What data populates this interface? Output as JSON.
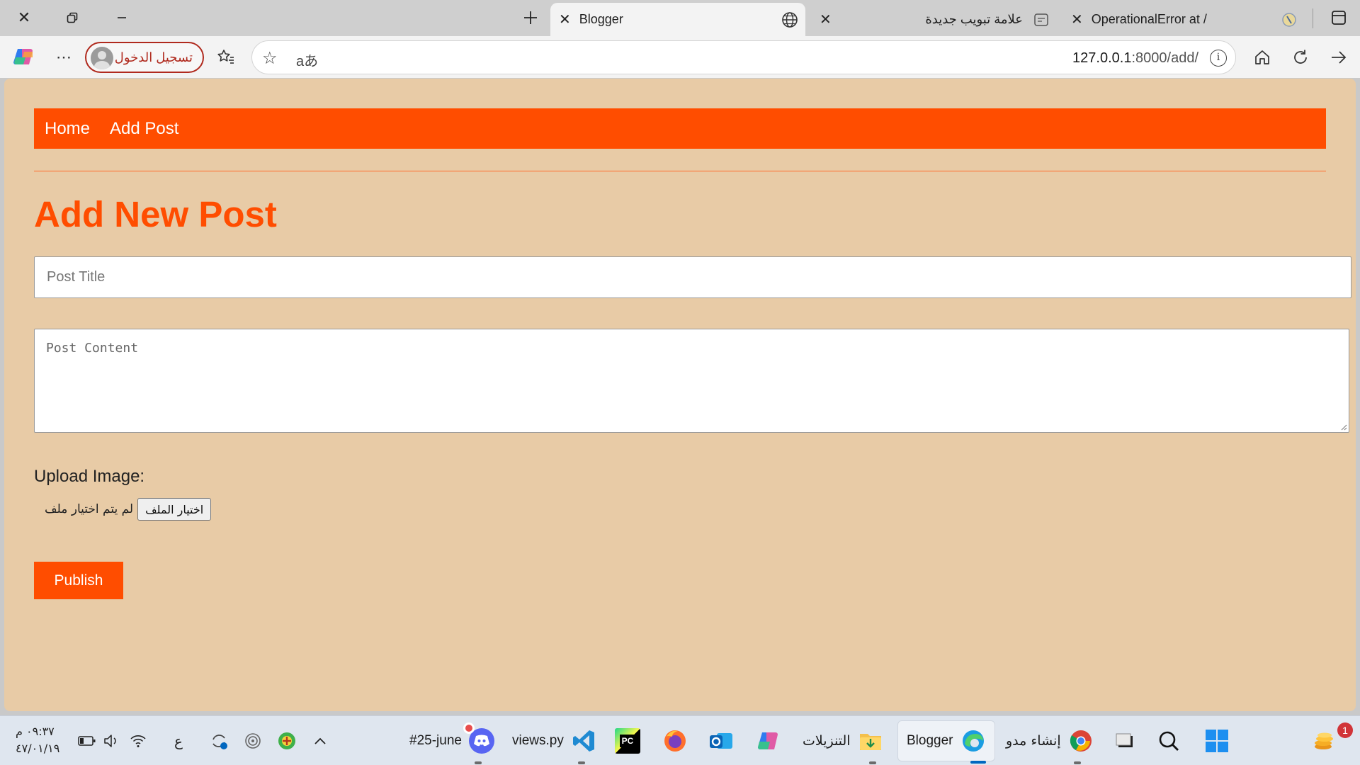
{
  "browser": {
    "tabs": [
      {
        "title": "Blogger",
        "active": true
      },
      {
        "title": "علامة تبويب جديدة",
        "active": false
      },
      {
        "title": "OperationalError at /",
        "active": false
      }
    ],
    "profile_label": "تسجيل الدخول",
    "url_host": "127.0.0.1",
    "url_path": ":8000/add/",
    "translate_glyph": "aあ"
  },
  "page": {
    "nav": {
      "home": "Home",
      "add_post": "Add Post"
    },
    "title": "Add New Post",
    "post_title_placeholder": "Post Title",
    "post_content_placeholder": "Post Content",
    "upload_label": "Upload Image:",
    "file_button": "اختيار الملف",
    "file_status": "لم يتم اختيار ملف",
    "publish_label": "Publish",
    "colors": {
      "accent": "#ff4d00",
      "background": "#e8cba6"
    }
  },
  "taskbar": {
    "items": [
      {
        "label": "#25-june",
        "icon": "discord-icon"
      },
      {
        "label": "views.py",
        "icon": "vscode-icon"
      },
      {
        "label": "",
        "icon": "pycharm-icon"
      },
      {
        "label": "",
        "icon": "firefox-icon"
      },
      {
        "label": "",
        "icon": "outlook-icon"
      },
      {
        "label": "",
        "icon": "copilot-icon"
      },
      {
        "label": "التنزيلات",
        "icon": "downloads-folder-icon"
      },
      {
        "label": "Blogger",
        "icon": "edge-icon",
        "active": true
      },
      {
        "label": "إنشاء مدو",
        "icon": "chrome-icon"
      }
    ],
    "ime_label": "ع",
    "clock_time": "٠٩:٣٧ م",
    "clock_date": "٤٧/٠١/١٩",
    "notification_count": "1"
  }
}
